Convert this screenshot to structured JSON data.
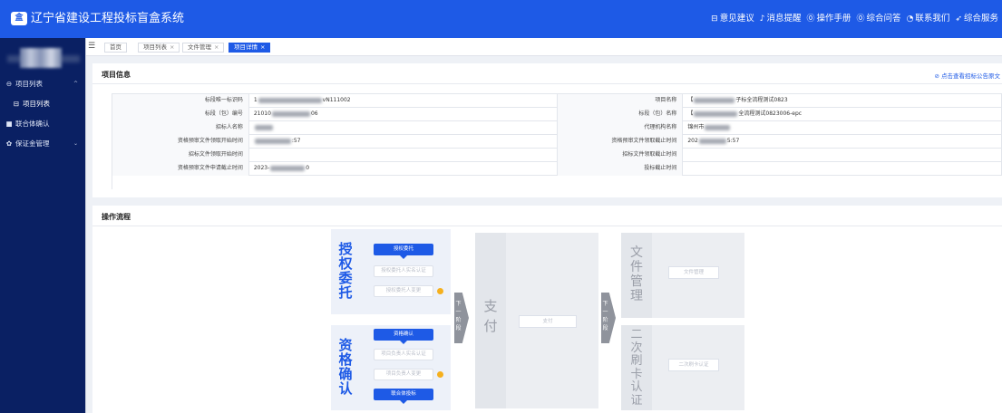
{
  "app": {
    "title": "辽宁省建设工程投标盲盒系统",
    "logo_text": "盒"
  },
  "topnav": [
    {
      "icon": "feedback-icon",
      "glyph": "⊟",
      "label": "意见建议"
    },
    {
      "icon": "bell-icon",
      "glyph": "♪",
      "label": "消息提醒"
    },
    {
      "icon": "help-icon",
      "glyph": "⓪",
      "label": "操作手册"
    },
    {
      "icon": "help-icon",
      "glyph": "⓪",
      "label": "综合问答"
    },
    {
      "icon": "headset-icon",
      "glyph": "◔",
      "label": "联系我们"
    },
    {
      "icon": "send-icon",
      "glyph": "➶",
      "label": "综合服务"
    }
  ],
  "sidebar": {
    "items": [
      {
        "label": "项目列表",
        "glyph": "⊖",
        "expanded": true
      },
      {
        "label": "项目列表",
        "glyph": "⊟"
      },
      {
        "label": "联合体确认",
        "glyph": "■"
      },
      {
        "label": "保证金管理",
        "glyph": "✿",
        "arrow": "⌄"
      }
    ]
  },
  "tabs": [
    {
      "label": "首页"
    },
    {
      "label": "项目列表",
      "close": "×"
    },
    {
      "label": "文件管理",
      "close": "×"
    },
    {
      "label": "项目详情",
      "close": "×",
      "active": true
    }
  ],
  "info": {
    "title": "项目信息",
    "notice_link": "点击查看招标公告原文",
    "rows": [
      {
        "l1": "标段唯一标识码",
        "v1": "1",
        "v1tail": "vN111002",
        "l2": "项目名称",
        "v2": "【",
        "v2tail": "子标全流程测试0823"
      },
      {
        "l1": "标段（包）编号",
        "v1": "21010",
        "v1tail": "06",
        "l2": "标段（包）名称",
        "v2": "【",
        "v2tail": "全流程测试0823006-epc"
      },
      {
        "l1": "招标人名称",
        "v1": "",
        "v1tail": "",
        "l2": "代理机构名称",
        "v2": "锦州市",
        "v2tail": ""
      },
      {
        "l1": "资格预审文件领取开始时间",
        "v1": "",
        "v1tail": ":57",
        "l2": "资格预审文件领取截止时间",
        "v2": "202",
        "v2tail": "5:57"
      },
      {
        "l1": "招标文件领取开始时间",
        "v1": "",
        "v1tail": "",
        "l2": "招标文件领取截止时间",
        "v2": "",
        "v2tail": ""
      },
      {
        "l1": "资格预审文件申请截止时间",
        "v1": "2023-",
        "v1tail": "0",
        "l2": "投标截止时间",
        "v2": "",
        "v2tail": ""
      }
    ]
  },
  "flow": {
    "title": "操作流程",
    "stage1": {
      "title": "授权委托",
      "nodes": [
        "授权委托",
        "授权委托人实名认证",
        "授权委托人变更"
      ]
    },
    "stage2": {
      "title": "资格确认",
      "nodes": [
        "资格确认",
        "项目负责人实名认证",
        "项目负责人变更",
        "联合体投标"
      ]
    },
    "next_step": "下一阶段",
    "pay": {
      "title": "支付",
      "node": "支付"
    },
    "file": {
      "title": "文件管理",
      "node": "文件管理"
    },
    "card": {
      "title": "二次刷卡认证",
      "node": "二次刷卡认证"
    }
  }
}
